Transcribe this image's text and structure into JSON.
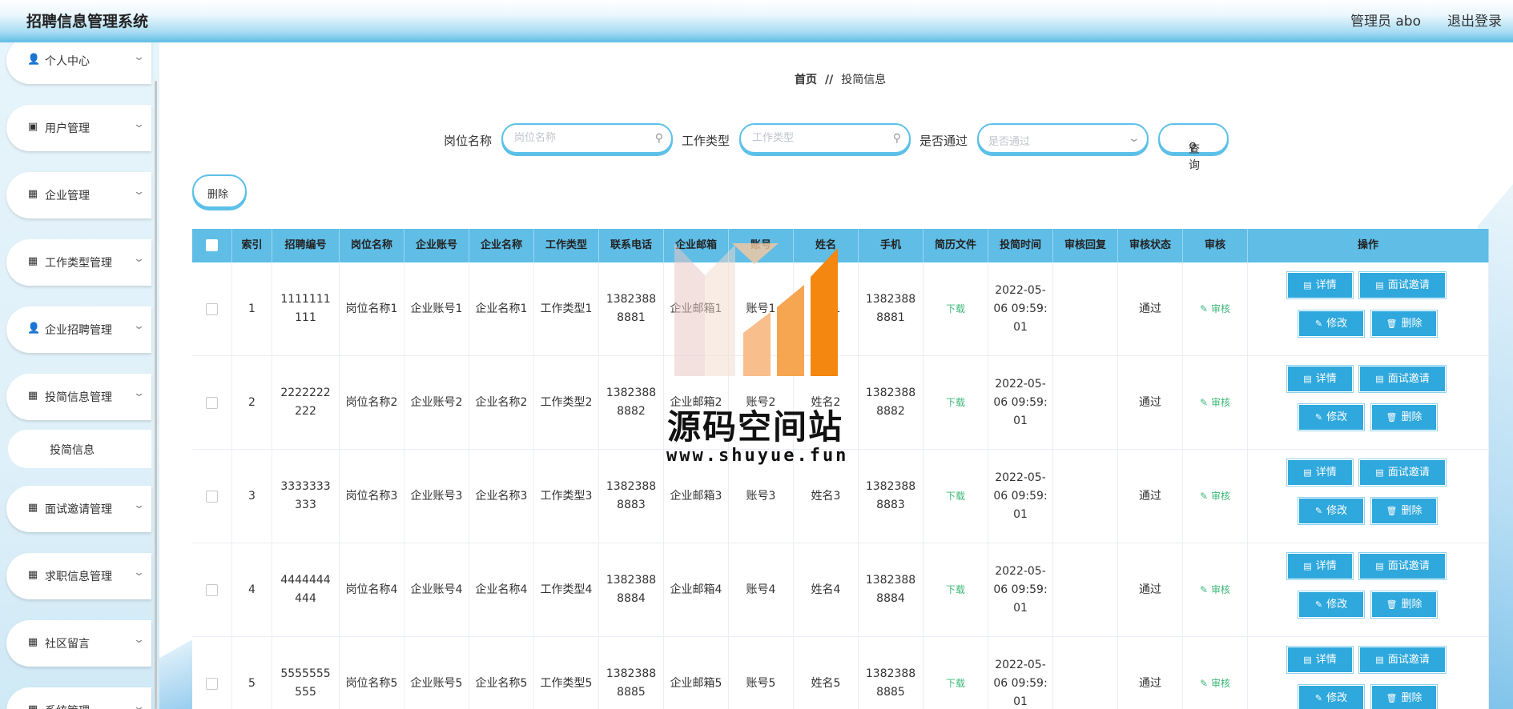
{
  "app_title": "招聘信息管理系统",
  "header": {
    "user": "管理员 abo",
    "logout": "退出登录"
  },
  "sidebar": {
    "items": [
      {
        "label": "个人中心",
        "icon": "user-icon",
        "glyph": "👤"
      },
      {
        "label": "用户管理",
        "icon": "clipboard-icon",
        "glyph": "▣"
      },
      {
        "label": "企业管理",
        "icon": "grid-icon",
        "glyph": "▦"
      },
      {
        "label": "工作类型管理",
        "icon": "grid-icon",
        "glyph": "▦"
      },
      {
        "label": "企业招聘管理",
        "icon": "user-icon",
        "glyph": "👤"
      },
      {
        "label": "投简信息管理",
        "icon": "grid-icon",
        "glyph": "▦"
      },
      {
        "label": "面试邀请管理",
        "icon": "grid-icon",
        "glyph": "▦"
      },
      {
        "label": "求职信息管理",
        "icon": "grid-icon",
        "glyph": "▦"
      },
      {
        "label": "社区留言",
        "icon": "grid-icon",
        "glyph": "▦"
      },
      {
        "label": "系统管理",
        "icon": "grid-icon",
        "glyph": "▦"
      }
    ],
    "sub_item": "投简信息"
  },
  "breadcrumb": {
    "home": "首页",
    "sep": "//",
    "current": "投简信息"
  },
  "search": {
    "position_label": "岗位名称",
    "position_placeholder": "岗位名称",
    "worktype_label": "工作类型",
    "worktype_placeholder": "工作类型",
    "passed_label": "是否通过",
    "passed_placeholder": "是否通过",
    "query": "查询"
  },
  "delete_label": "删除",
  "table": {
    "headers": [
      "索引",
      "招聘编号",
      "岗位名称",
      "企业账号",
      "企业名称",
      "工作类型",
      "联系电话",
      "企业邮箱",
      "账号",
      "姓名",
      "手机",
      "简历文件",
      "投简时间",
      "审核回复",
      "审核状态",
      "审核",
      "操作"
    ],
    "rows": [
      {
        "index": "1",
        "code": "1111111111",
        "position": "岗位名称1",
        "account": "企业账号1",
        "company": "企业名称1",
        "worktype": "工作类型1",
        "phone": "13823888881",
        "email": "企业邮箱1",
        "user": "账号1",
        "name": "姓名1",
        "mobile": "13823888881",
        "file": "下载",
        "time": "2022-05-06 09:59:01",
        "reply": "",
        "status": "通过",
        "audit": "审核"
      },
      {
        "index": "2",
        "code": "2222222222",
        "position": "岗位名称2",
        "account": "企业账号2",
        "company": "企业名称2",
        "worktype": "工作类型2",
        "phone": "13823888882",
        "email": "企业邮箱2",
        "user": "账号2",
        "name": "姓名2",
        "mobile": "13823888882",
        "file": "下载",
        "time": "2022-05-06 09:59:01",
        "reply": "",
        "status": "通过",
        "audit": "审核"
      },
      {
        "index": "3",
        "code": "3333333333",
        "position": "岗位名称3",
        "account": "企业账号3",
        "company": "企业名称3",
        "worktype": "工作类型3",
        "phone": "13823888883",
        "email": "企业邮箱3",
        "user": "账号3",
        "name": "姓名3",
        "mobile": "13823888883",
        "file": "下载",
        "time": "2022-05-06 09:59:01",
        "reply": "",
        "status": "通过",
        "audit": "审核"
      },
      {
        "index": "4",
        "code": "4444444444",
        "position": "岗位名称4",
        "account": "企业账号4",
        "company": "企业名称4",
        "worktype": "工作类型4",
        "phone": "13823888884",
        "email": "企业邮箱4",
        "user": "账号4",
        "name": "姓名4",
        "mobile": "13823888884",
        "file": "下载",
        "time": "2022-05-06 09:59:01",
        "reply": "",
        "status": "通过",
        "audit": "审核"
      },
      {
        "index": "5",
        "code": "5555555555",
        "position": "岗位名称5",
        "account": "企业账号5",
        "company": "企业名称5",
        "worktype": "工作类型5",
        "phone": "13823888885",
        "email": "企业邮箱5",
        "user": "账号5",
        "name": "姓名5",
        "mobile": "13823888885",
        "file": "下载",
        "time": "2022-05-06 09:59:01",
        "reply": "",
        "status": "通过",
        "audit": "审核"
      }
    ],
    "actions": {
      "detail": "详情",
      "invite": "面试邀请",
      "edit": "修改",
      "delete": "删除"
    }
  },
  "watermark": {
    "text": "源码空间站",
    "url": "www.shuyue.fun"
  }
}
